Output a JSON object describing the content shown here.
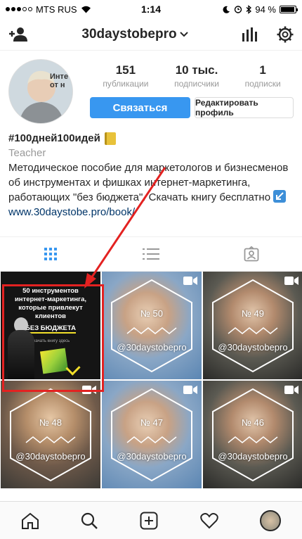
{
  "status_bar": {
    "carrier": "MTS RUS",
    "time": "1:14",
    "battery": "94 %",
    "battery_level": 0.94
  },
  "header": {
    "username": "30daystobepro"
  },
  "profile": {
    "avatar_text": "Инте от н",
    "stats": [
      {
        "value": "151",
        "label": "публикации"
      },
      {
        "value": "10 тыс.",
        "label": "подписчики"
      },
      {
        "value": "1",
        "label": "подписки"
      }
    ],
    "contact_label": "Связаться",
    "edit_label": "Редактировать профиль"
  },
  "bio": {
    "name": "#100дней100идей",
    "category": "Teacher",
    "text": "Методическое пособие для маркетологов и бизнесменов об инструментах и фишках интернет-маркетинга, работающих \"без бюджета\". Скачать книгу бесплатно",
    "link": "www.30daystobe.pro/book/"
  },
  "promo_post": {
    "title": "50 инструментов интернет-маркетинга, которые привлекут клиентов",
    "subtitle": "БЕЗ БЮДЖЕТА",
    "small": "скачать книгу здесь"
  },
  "posts": [
    {
      "num": "№ 50",
      "handle": "@30daystobepro"
    },
    {
      "num": "№ 49",
      "handle": "@30daystobepro"
    },
    {
      "num": "№ 48",
      "handle": "@30daystobepro"
    },
    {
      "num": "№ 47",
      "handle": "@30daystobepro"
    },
    {
      "num": "№ 46",
      "handle": "@30daystobepro"
    }
  ],
  "colors": {
    "accent": "#3897f0",
    "annotation": "#e32221"
  }
}
